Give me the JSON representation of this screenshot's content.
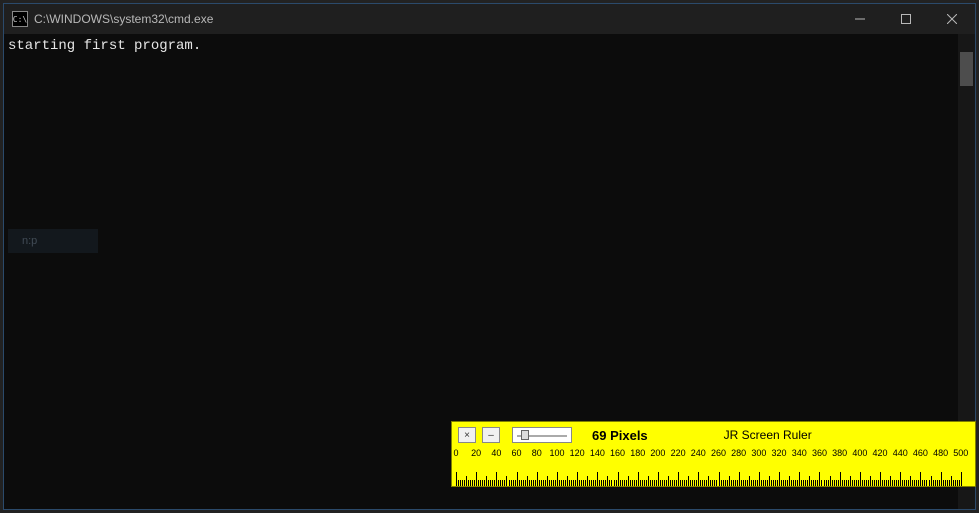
{
  "cmd": {
    "icon_text": "C:\\",
    "title": "C:\\WINDOWS\\system32\\cmd.exe",
    "output": "starting first program.",
    "faded_label": "n:p"
  },
  "ruler": {
    "close_label": "×",
    "minimize_label": "–",
    "reading": "69 Pixels",
    "title": "JR Screen Ruler",
    "tick_start": 0,
    "tick_end": 500,
    "tick_step_label": 20,
    "tick_step_minor": 2
  }
}
